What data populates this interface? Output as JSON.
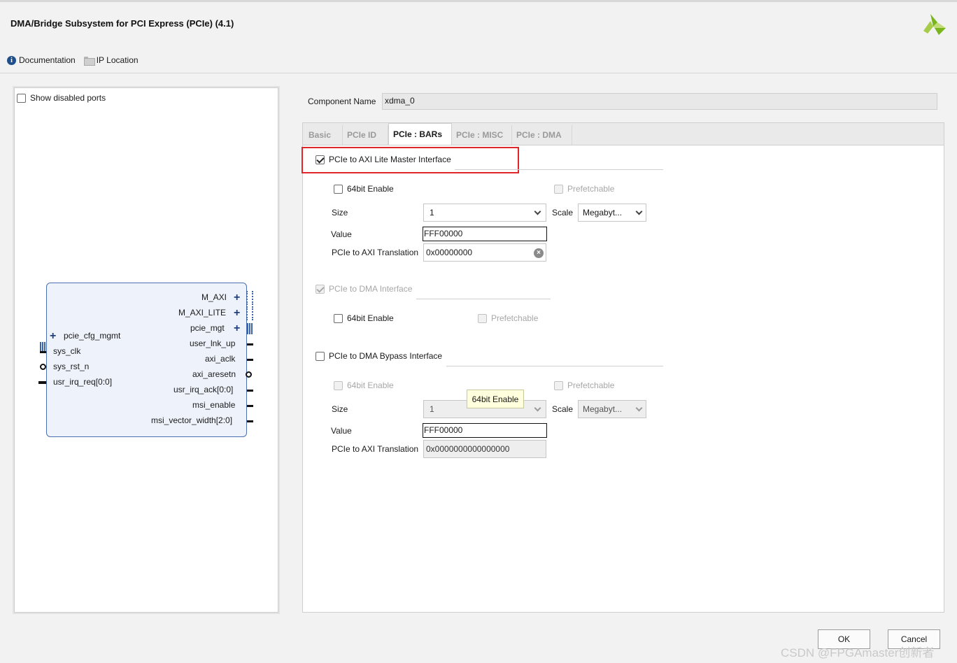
{
  "window": {
    "title": "DMA/Bridge Subsystem for PCI Express (PCIe) (4.1)"
  },
  "toolbar": {
    "documentation": "Documentation",
    "ip_location": "IP Location"
  },
  "symbol_panel": {
    "show_disabled_ports": "Show disabled ports",
    "block": {
      "right_ports": [
        "M_AXI",
        "M_AXI_LITE",
        "pcie_mgt",
        "user_lnk_up",
        "axi_aclk",
        "axi_aresetn",
        "usr_irq_ack[0:0]",
        "msi_enable",
        "msi_vector_width[2:0]"
      ],
      "left_ports": [
        "pcie_cfg_mgmt",
        "sys_clk",
        "sys_rst_n",
        "usr_irq_req[0:0]"
      ]
    }
  },
  "component": {
    "label": "Component Name",
    "value": "xdma_0"
  },
  "tabs": [
    {
      "label": "Basic"
    },
    {
      "label": "PCIe ID"
    },
    {
      "label": "PCIe : BARs"
    },
    {
      "label": "PCIe : MISC"
    },
    {
      "label": "PCIe : DMA"
    }
  ],
  "bars": {
    "axi_lite": {
      "title": "PCIe to AXI Lite Master Interface",
      "enable64": "64bit Enable",
      "prefetchable": "Prefetchable",
      "size_label": "Size",
      "size_value": "1",
      "scale_label": "Scale",
      "scale_value": "Megabyt...",
      "value_label": "Value",
      "value_value": "FFF00000",
      "translation_label": "PCIe to AXI Translation",
      "translation_value": "0x00000000"
    },
    "dma": {
      "title": "PCIe to DMA Interface",
      "enable64": "64bit Enable",
      "prefetchable": "Prefetchable"
    },
    "bypass": {
      "title": "PCIe to DMA Bypass Interface",
      "enable64": "64bit Enable",
      "prefetchable": "Prefetchable",
      "size_label": "Size",
      "size_value": "1",
      "scale_label": "Scale",
      "scale_value": "Megabyt...",
      "value_label": "Value",
      "value_value": "FFF00000",
      "translation_label": "PCIe to AXI Translation",
      "translation_value": "0x0000000000000000"
    },
    "tooltip": "64bit Enable"
  },
  "buttons": {
    "ok": "OK",
    "cancel": "Cancel"
  },
  "watermark": "CSDN @FPGAmaster创新者",
  "colors": {
    "highlight": "#e0262b",
    "logo_green": "#7ab51d"
  }
}
